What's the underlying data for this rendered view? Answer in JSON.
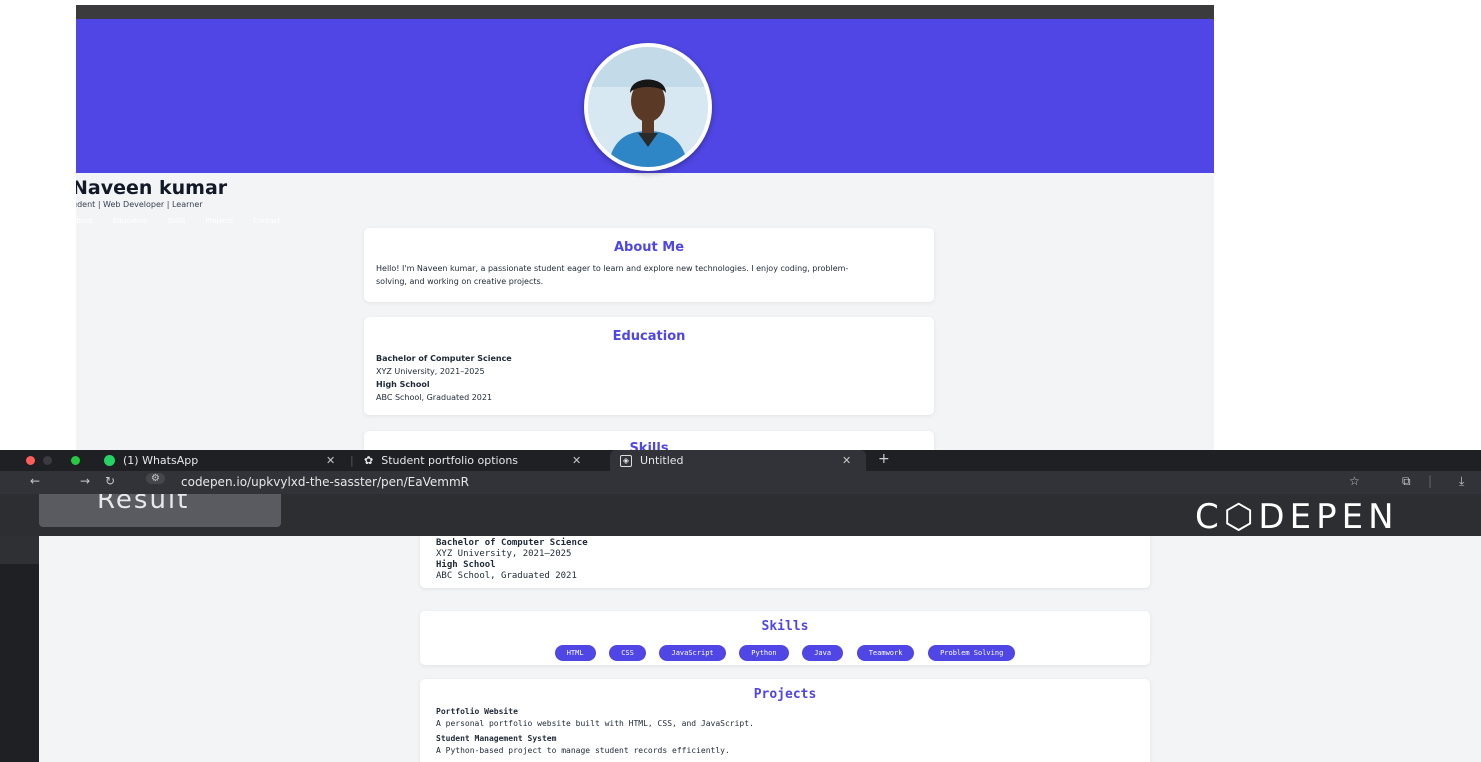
{
  "portfolio": {
    "name": "Naveen kumar",
    "tagline": "udent | Web Developer | Learner",
    "nav": [
      "About",
      "Education",
      "Skills",
      "Projects",
      "Contact"
    ],
    "about": {
      "title": "About Me",
      "text_line1": "Hello! I'm Naveen kumar, a passionate student eager to learn and explore new technologies. I enjoy coding, problem-",
      "text_line2": "solving, and working on creative projects."
    },
    "education": {
      "title": "Education",
      "degree": "Bachelor of Computer Science",
      "degree_detail": "XYZ University, 2021–2025",
      "school": "High School",
      "school_detail": "ABC School, Graduated 2021"
    },
    "skills_title_partial": "Skills"
  },
  "browser": {
    "tabs": [
      {
        "label": "(1) WhatsApp"
      },
      {
        "label": "Student portfolio options"
      },
      {
        "label": "Untitled"
      }
    ],
    "new_tab": "+",
    "url": "codepen.io/upkvylxd-the-sasster/pen/EaVemmR"
  },
  "codepen": {
    "result_label": "Result",
    "logo": "C⬡DEPEN",
    "education": {
      "degree": "Bachelor of Computer Science",
      "degree_detail": "XYZ University, 2021–2025",
      "school": "High School",
      "school_detail": "ABC School, Graduated 2021"
    },
    "skills": {
      "title": "Skills",
      "items": [
        "HTML",
        "CSS",
        "JavaScript",
        "Python",
        "Java",
        "Teamwork",
        "Problem Solving"
      ]
    },
    "projects": {
      "title": "Projects",
      "items": [
        {
          "title": "Portfolio Website",
          "desc": "A personal portfolio website built with HTML, CSS, and JavaScript."
        },
        {
          "title": "Student Management System",
          "desc": "A Python-based project to manage student records efficiently."
        }
      ]
    }
  },
  "colors": {
    "accent": "#4f46e5",
    "chrome_dark": "#1f2023",
    "chrome": "#323338"
  }
}
